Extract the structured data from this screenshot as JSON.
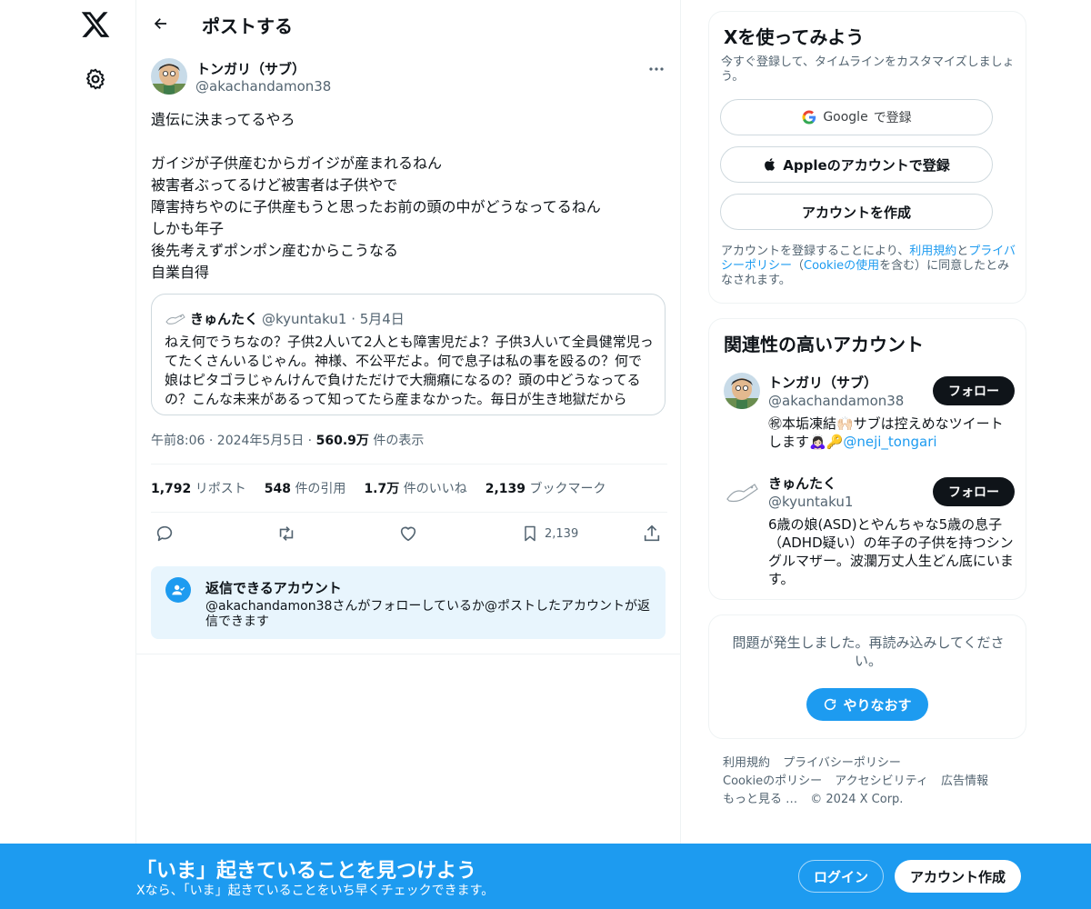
{
  "header": {
    "title": "ポストする"
  },
  "post": {
    "author_name": "トンガリ（サブ）",
    "author_handle": "@akachandamon38",
    "text": "遺伝に決まってるやろ\n\nガイジが子供産むからガイジが産まれるねん\n被害者ぶってるけど被害者は子供やで\n障害持ちやのに子供産もうと思ったお前の頭の中がどうなってるねん\nしかも年子\n後先考えずポンポン産むからこうなる\n自業自得",
    "quote": {
      "name": "きゅんたく",
      "handle": "@kyuntaku1",
      "date": "· 5月4日",
      "text": "ねえ何でうちなの？子供2人いて2人とも障害児だよ？子供3人いて全員健常児ってたくさんいるじゃん。神様、不公平だよ。何で息子は私の事を殴るの？何で娘はピタゴラじゃんけんで負けただけで大癇癪になるの？頭の中どうなってるの？こんな未来があるって知ってたら産まなかった。毎日が生き地獄だから"
    },
    "time": "午前8:06 · 2024年5月5日 ·",
    "views_count": "560.9万",
    "views_label": "件の表示",
    "stats": [
      {
        "count": "1,792",
        "label": "リポスト"
      },
      {
        "count": "548",
        "label": "件の引用"
      },
      {
        "count": "1.7万",
        "label": "件のいいね"
      },
      {
        "count": "2,139",
        "label": "ブックマーク"
      }
    ],
    "actions": {
      "reply_icon": "reply-icon",
      "repost_icon": "repost-icon",
      "like_icon": "heart-icon",
      "bookmark_icon": "bookmark-icon",
      "bookmark_count": "2,139",
      "share_icon": "share-icon"
    }
  },
  "reply_info": {
    "title": "返信できるアカウント",
    "desc": "@akachandamon38さんがフォローしているか@ポストしたアカウントが返信できます"
  },
  "signup_card": {
    "title": "Xを使ってみよう",
    "subtitle": "今すぐ登録して、タイムラインをカスタマイズしましょう。",
    "google_brand": "Google",
    "google_label": "で登録",
    "apple_label": "Appleのアカウントで登録",
    "create_label": "アカウントを作成",
    "terms_1": "アカウントを登録することにより、",
    "terms_link1": "利用規約",
    "terms_2": "と",
    "terms_link2": "プライバシーポリシー",
    "terms_3": "（",
    "terms_link3": "Cookieの使用",
    "terms_4": "を含む）に同意したとみなされます。"
  },
  "related": {
    "title": "関連性の高いアカウント",
    "accounts": [
      {
        "name": "トンガリ（サブ）",
        "handle": "@akachandamon38",
        "bio": "㊗本垢凍結🙌🏻サブは控えめなツイートします🙇🏻‍♀️🔑",
        "bio_link": "@neji_tongari",
        "follow": "フォロー"
      },
      {
        "name": "きゅんたく",
        "handle": "@kyuntaku1",
        "bio": "6歳の娘(ASD)とやんちゃな5歳の息子（ADHD疑い）の年子の子供を持つシングルマザー。波瀾万丈人生どん底にいます。",
        "follow": "フォロー"
      }
    ]
  },
  "error_card": {
    "text": "問題が発生しました。再読み込みしてください。",
    "retry": "やりなおす"
  },
  "footer": {
    "links": [
      "利用規約",
      "プライバシーポリシー",
      "Cookieのポリシー",
      "アクセシビリティ",
      "広告情報",
      "もっと見る …"
    ],
    "copyright": "© 2024 X Corp."
  },
  "bottom_bar": {
    "title": "「いま」起きていることを見つけよう",
    "subtitle": "Xなら、「いま」起きていることをいち早くチェックできます。",
    "login": "ログイン",
    "signup": "アカウント作成"
  },
  "colors": {
    "accent": "#1d9bf0",
    "text": "#0f1419",
    "muted": "#536471"
  }
}
